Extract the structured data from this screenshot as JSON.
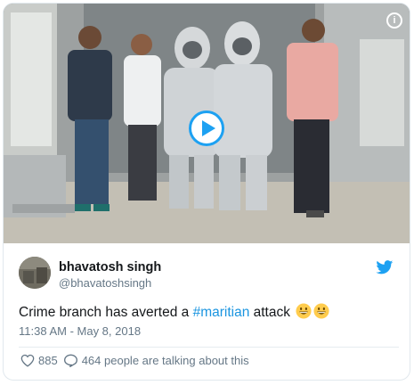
{
  "media": {
    "info_icon": "info-icon",
    "play_icon": "play-icon",
    "accent": "#1da1f2"
  },
  "author": {
    "display_name": "bhavatosh singh",
    "handle": "@bhavatoshsingh"
  },
  "tweet": {
    "text_before": "Crime branch has averted a ",
    "hashtag": "#maritian",
    "text_after": " attack ",
    "emojis": [
      "grinning-face-emoji",
      "grinning-face-emoji"
    ],
    "timestamp": "11:38 AM - May 8, 2018"
  },
  "actions": {
    "likes": "885",
    "talking": "464 people are talking about this"
  },
  "colors": {
    "link": "#1b95e0",
    "text": "#14171a",
    "muted": "#657786"
  }
}
